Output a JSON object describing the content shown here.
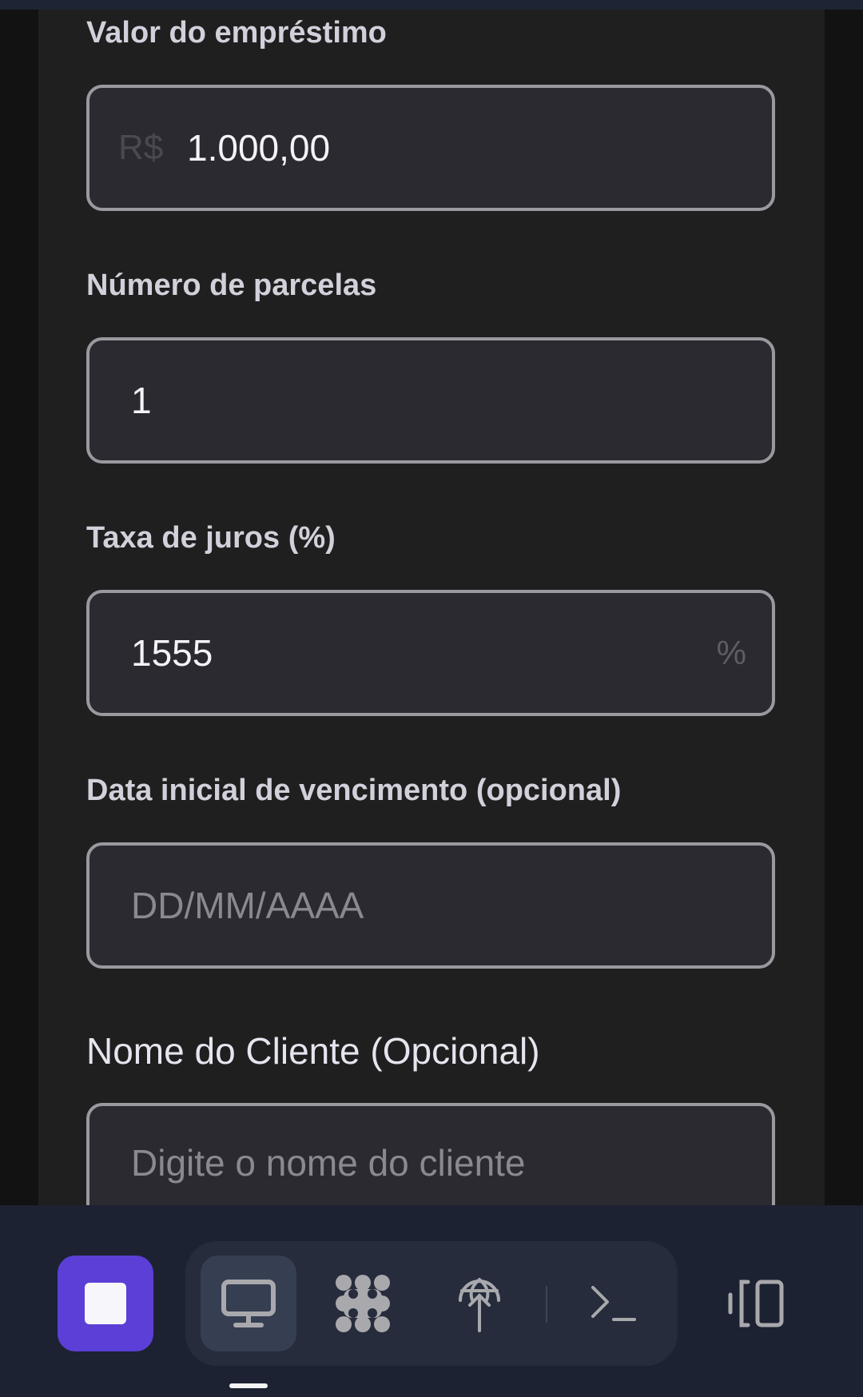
{
  "form": {
    "loan_amount": {
      "label": "Valor do empréstimo",
      "prefix": "R$",
      "value": "1.000,00"
    },
    "installments": {
      "label": "Número de parcelas",
      "value": "1"
    },
    "interest_rate": {
      "label": "Taxa de juros (%)",
      "value": "1555",
      "suffix": "%"
    },
    "due_date": {
      "label": "Data inicial de vencimento (opcional)",
      "placeholder": "DD/MM/AAAA"
    },
    "client_name": {
      "label": "Nome do Cliente (Opcional)",
      "placeholder": "Digite o nome do cliente"
    }
  },
  "toolbar": {
    "buttons": [
      {
        "icon": "stop-icon"
      },
      {
        "icon": "monitor-icon",
        "active": true
      },
      {
        "icon": "dots-grid-icon"
      },
      {
        "icon": "antenna-icon"
      },
      {
        "icon": "terminal-icon"
      },
      {
        "icon": "side-panel-icon"
      }
    ]
  },
  "colors": {
    "accent": "#5b3fd6",
    "page_background": "#1f1f1f",
    "input_background": "#2b2a31",
    "input_border": "#9a99a0",
    "toolbar_background": "#1c2232"
  }
}
